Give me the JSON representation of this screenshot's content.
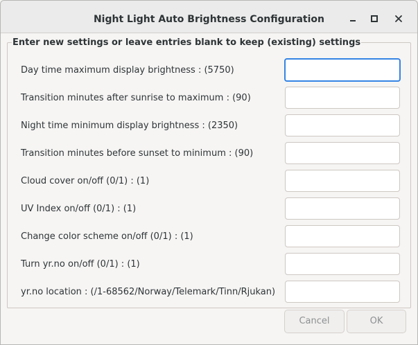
{
  "window": {
    "title": "Night Light Auto Brightness Configuration"
  },
  "frame": {
    "label": "Enter new settings or leave entries blank to keep (existing) settings"
  },
  "fields": [
    {
      "label": "Day time maximum display brightness : (5750)",
      "value": "",
      "placeholder": "",
      "focused": true
    },
    {
      "label": "Transition minutes after sunrise to maximum : (90)",
      "value": "",
      "placeholder": ""
    },
    {
      "label": "Night time minimum display brightness : (2350)",
      "value": "",
      "placeholder": ""
    },
    {
      "label": "Transition minutes before sunset to minimum : (90)",
      "value": "",
      "placeholder": ""
    },
    {
      "label": "Cloud cover on/off (0/1) : (1)",
      "value": "",
      "placeholder": ""
    },
    {
      "label": "UV Index on/off (0/1) : (1)",
      "value": "",
      "placeholder": ""
    },
    {
      "label": "Change color scheme on/off (0/1) : (1)",
      "value": "",
      "placeholder": ""
    },
    {
      "label": "Turn yr.no on/off (0/1) : (1)",
      "value": "",
      "placeholder": ""
    },
    {
      "label": "yr.no location : (/1-68562/Norway/Telemark/Tinn/Rjukan)",
      "value": "",
      "placeholder": ""
    }
  ],
  "buttons": {
    "cancel_label": "Cancel",
    "ok_label": "OK"
  },
  "icons": {
    "minimize": "minimize-icon",
    "maximize": "maximize-icon",
    "close": "close-icon"
  },
  "colors": {
    "focus_accent": "#3584e4",
    "titlebar": "#ebebeb",
    "window_bg": "#f6f5f4",
    "disabled_text": "#8d9091"
  }
}
